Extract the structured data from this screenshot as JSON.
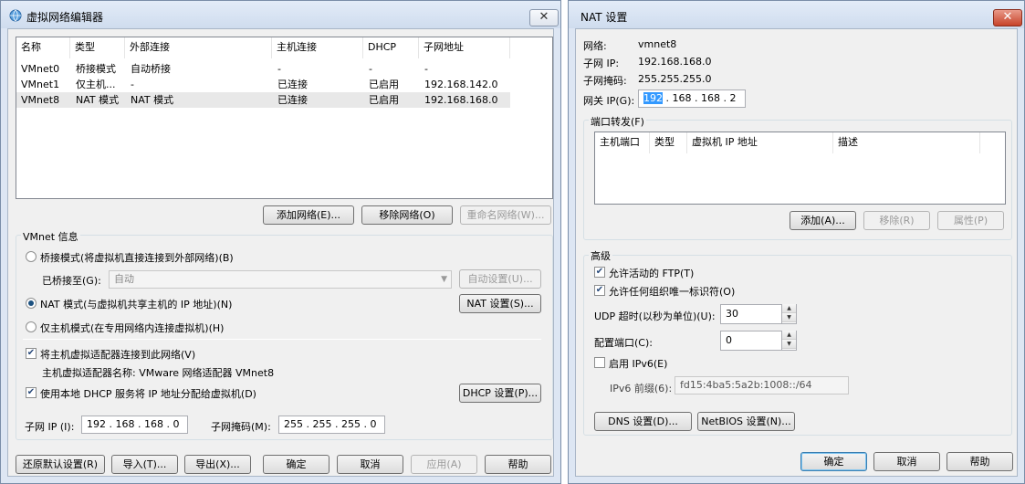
{
  "left": {
    "title": "虚拟网络编辑器",
    "close_glyph": "✕",
    "columns": [
      "名称",
      "类型",
      "外部连接",
      "主机连接",
      "DHCP",
      "子网地址"
    ],
    "rows": [
      {
        "name": "VMnet0",
        "type": "桥接模式",
        "external": "自动桥接",
        "host": "-",
        "dhcp": "-",
        "subnet": "-"
      },
      {
        "name": "VMnet1",
        "type": "仅主机...",
        "external": "-",
        "host": "已连接",
        "dhcp": "已启用",
        "subnet": "192.168.142.0"
      },
      {
        "name": "VMnet8",
        "type": "NAT 模式",
        "external": "NAT 模式",
        "host": "已连接",
        "dhcp": "已启用",
        "subnet": "192.168.168.0",
        "selected": true
      }
    ],
    "buttons": {
      "add_network": "添加网络(E)...",
      "remove_network": "移除网络(O)",
      "rename_network": "重命名网络(W)..."
    },
    "vmnet_info": {
      "title": "VMnet 信息",
      "bridged_mode": "桥接模式(将虚拟机直接连接到外部网络)(B)",
      "bridged_to_label": "已桥接至(G):",
      "bridged_to_value": "自动",
      "auto_settings": "自动设置(U)...",
      "nat_mode": "NAT 模式(与虚拟机共享主机的 IP 地址)(N)",
      "nat_settings": "NAT 设置(S)...",
      "host_only_mode": "仅主机模式(在专用网络内连接虚拟机)(H)",
      "connect_host_adapter": "将主机虚拟适配器连接到此网络(V)",
      "adapter_name": "主机虚拟适配器名称: VMware 网络适配器 VMnet8",
      "use_dhcp": "使用本地 DHCP 服务将 IP 地址分配给虚拟机(D)",
      "dhcp_settings": "DHCP 设置(P)...",
      "subnet_ip_label": "子网 IP (I):",
      "subnet_ip": [
        "192",
        "168",
        "168",
        "0"
      ],
      "subnet_mask_label": "子网掩码(M):",
      "subnet_mask": [
        "255",
        "255",
        "255",
        "0"
      ]
    },
    "footer": {
      "restore_defaults": "还原默认设置(R)",
      "import": "导入(T)...",
      "export": "导出(X)...",
      "ok": "确定",
      "cancel": "取消",
      "apply": "应用(A)",
      "help": "帮助"
    }
  },
  "right": {
    "title": "NAT 设置",
    "close_glyph": "✕",
    "network_label": "网络:",
    "network_value": "vmnet8",
    "subnet_ip_label": "子网 IP:",
    "subnet_ip_value": "192.168.168.0",
    "subnet_mask_label": "子网掩码:",
    "subnet_mask_value": "255.255.255.0",
    "gateway_label": "网关 IP(G):",
    "gateway_ip": [
      "192",
      "168",
      "168",
      "2"
    ],
    "port_forwarding": {
      "title": "端口转发(F)",
      "columns": [
        "主机端口",
        "类型",
        "虚拟机 IP 地址",
        "描述"
      ],
      "add": "添加(A)...",
      "remove": "移除(R)",
      "properties": "属性(P)"
    },
    "advanced": {
      "title": "高级",
      "allow_active_ftp": "允许活动的 FTP(T)",
      "allow_any_oui": "允许任何组织唯一标识符(O)",
      "udp_timeout_label": "UDP 超时(以秒为单位)(U):",
      "udp_timeout_value": "30",
      "config_port_label": "配置端口(C):",
      "config_port_value": "0",
      "enable_ipv6": "启用 IPv6(E)",
      "ipv6_prefix_label": "IPv6 前缀(6):",
      "ipv6_prefix_value": "fd15:4ba5:5a2b:1008::/64",
      "dns_settings": "DNS 设置(D)...",
      "netbios_settings": "NetBIOS 设置(N)..."
    },
    "footer": {
      "ok": "确定",
      "cancel": "取消",
      "help": "帮助"
    }
  },
  "colors": {
    "frame": "#dde6f3",
    "client": "#f0f0f0",
    "selection": "#3399ff",
    "close_red": "#c7432a"
  },
  "icons": {
    "app": "network-globe-icon",
    "close": "close-icon",
    "dropdown": "chevron-down-icon",
    "check": "checkmark-icon"
  }
}
